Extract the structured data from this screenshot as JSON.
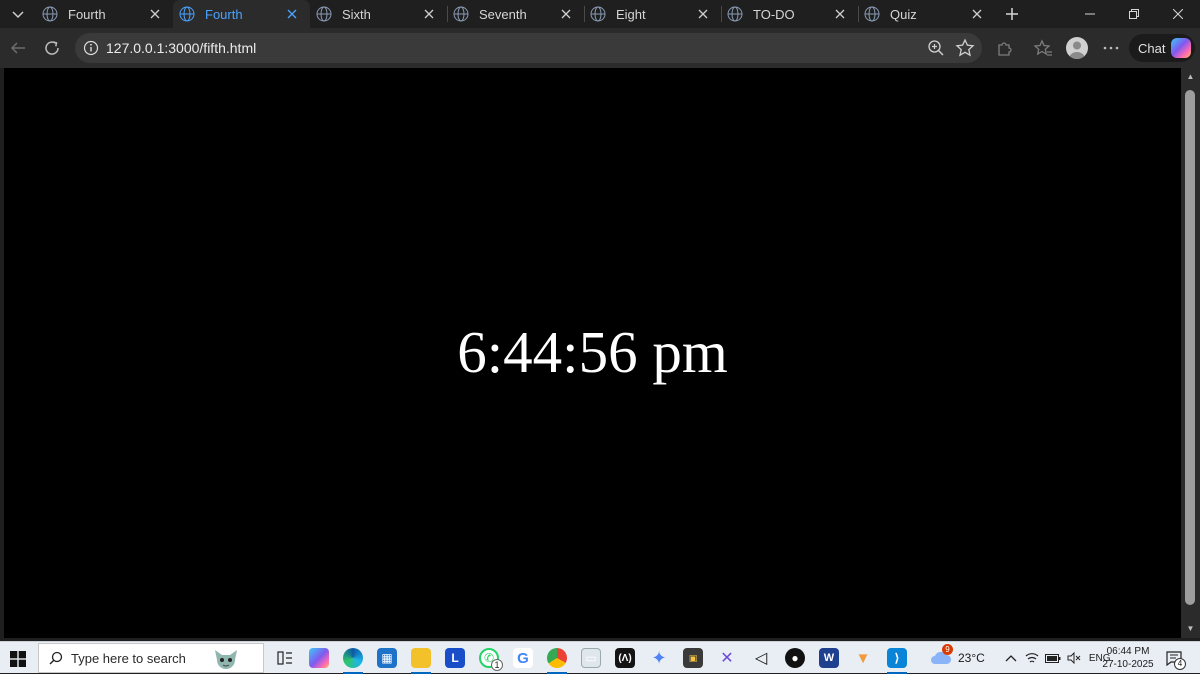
{
  "tabs": [
    {
      "title": "Fourth",
      "active": false
    },
    {
      "title": "Fourth",
      "active": true
    },
    {
      "title": "Sixth",
      "active": false
    },
    {
      "title": "Seventh",
      "active": false
    },
    {
      "title": "Eight",
      "active": false
    },
    {
      "title": "TO-DO",
      "active": false
    },
    {
      "title": "Quiz",
      "active": false
    }
  ],
  "toolbar": {
    "url": "127.0.0.1:3000/fifth.html",
    "chat_label": "Chat"
  },
  "page": {
    "clock_text": "6:44:56 pm"
  },
  "taskbar": {
    "search_placeholder": "Type here to search",
    "whatsapp_badge": "1",
    "weather_badge": "9",
    "temperature": "23°C",
    "language": "ENG",
    "time": "06:44 PM",
    "date": "27-10-2025",
    "notification_count": "4"
  },
  "colors": {
    "active_tab_text": "#4aa3ff",
    "page_background": "#000000",
    "clock_text": "#ffffff"
  }
}
